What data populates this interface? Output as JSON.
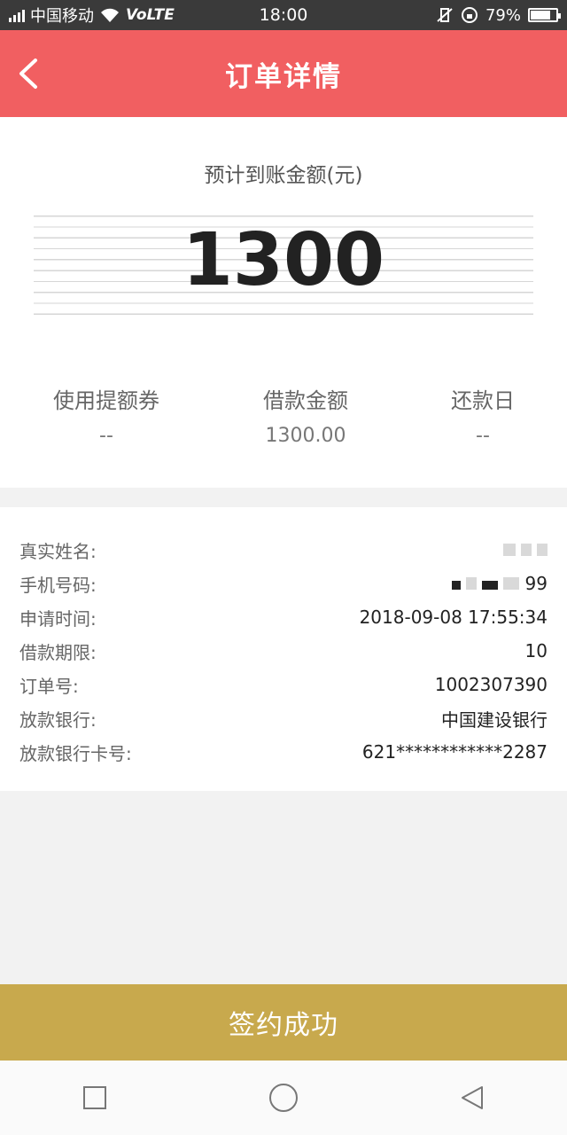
{
  "status_bar": {
    "carrier": "中国移动",
    "network": "VoLTE",
    "time": "18:00",
    "battery": "79%",
    "battery_level": 0.79
  },
  "header": {
    "title": "订单详情"
  },
  "summary": {
    "expected_label": "预计到账金额(元)",
    "amount": "1300",
    "stats": [
      {
        "label": "使用提额券",
        "value": "--"
      },
      {
        "label": "借款金额",
        "value": "1300.00"
      },
      {
        "label": "还款日",
        "value": "--"
      }
    ]
  },
  "details": {
    "rows": [
      {
        "label": "真实姓名:",
        "value": ""
      },
      {
        "label": "手机号码:",
        "value": "99"
      },
      {
        "label": "申请时间:",
        "value": "2018-09-08 17:55:34"
      },
      {
        "label": "借款期限:",
        "value": "10"
      },
      {
        "label": "订单号:",
        "value": "1002307390"
      },
      {
        "label": "放款银行:",
        "value": "中国建设银行"
      },
      {
        "label": "放款银行卡号:",
        "value": "621************2287"
      }
    ]
  },
  "footer": {
    "sign_label": "签约成功"
  },
  "colors": {
    "header_bg": "#f15f61",
    "button_bg": "#c8a94d"
  },
  "icons": {
    "back": "chevron-left-icon",
    "recent": "square-icon",
    "home": "circle-icon",
    "nav_back": "triangle-back-icon"
  }
}
